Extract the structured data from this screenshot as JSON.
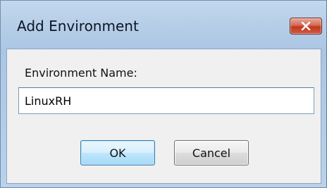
{
  "window": {
    "title": "Add Environment",
    "close_label": "✕"
  },
  "form": {
    "environment_name_label": "Environment Name:",
    "environment_name_value": "LinuxRH"
  },
  "buttons": {
    "ok_label": "OK",
    "cancel_label": "Cancel"
  },
  "colors": {
    "titlebar_tint": "#b8cfe8",
    "close_button": "#c0391f",
    "client_background": "#f0f0f0",
    "default_button": "#bee6fd"
  }
}
